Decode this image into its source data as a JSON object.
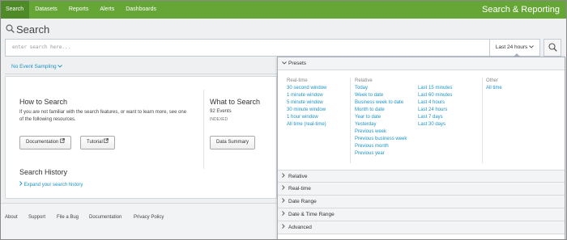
{
  "nav": {
    "tabs": [
      {
        "label": "Search",
        "active": true
      },
      {
        "label": "Datasets"
      },
      {
        "label": "Reports"
      },
      {
        "label": "Alerts"
      },
      {
        "label": "Dashboards"
      }
    ],
    "app_title": "Search & Reporting"
  },
  "search": {
    "page_title": "Search",
    "placeholder": "enter search here...",
    "time_range_label": "Last 24 hours",
    "sampling_label": "No Event Sampling"
  },
  "how_to": {
    "title": "How to Search",
    "text": "If you are not familiar with the search features, or want to learn more, see one of the following resources.",
    "documentation_label": "Documentation",
    "tutorial_label": "Tutorial"
  },
  "what_to": {
    "title": "What to Search",
    "events": "92 Events",
    "indexed": "INDEXED",
    "summary_label": "Data Summary"
  },
  "history": {
    "title": "Search History",
    "expand_label": "Expand your search history"
  },
  "footer": {
    "links": [
      "About",
      "Support",
      "File a Bug",
      "Documentation",
      "Privacy Policy"
    ]
  },
  "picker": {
    "presets_label": "Presets",
    "columns": {
      "realtime": {
        "heading": "Real-time",
        "items": [
          "30 second window",
          "1 minute window",
          "5 minute window",
          "30 minute window",
          "1 hour window",
          "All time (real-time)"
        ]
      },
      "relative1": {
        "heading": "Relative",
        "items": [
          "Today",
          "Week to date",
          "Business week to date",
          "Month to date",
          "Year to date",
          "Yesterday",
          "Previous week",
          "Previous business week",
          "Previous month",
          "Previous year"
        ]
      },
      "relative2": {
        "items": [
          "Last 15 minutes",
          "Last 60 minutes",
          "Last 4 hours",
          "Last 24 hours",
          "Last 7 days",
          "Last 30 days"
        ]
      },
      "other": {
        "heading": "Other",
        "items": [
          "All time"
        ]
      }
    },
    "sections": [
      "Relative",
      "Real-time",
      "Date Range",
      "Date & Time Range",
      "Advanced"
    ]
  },
  "colors": {
    "nav_bg": "#65a637",
    "nav_active": "#4e8a27",
    "link": "#1e93c6"
  }
}
